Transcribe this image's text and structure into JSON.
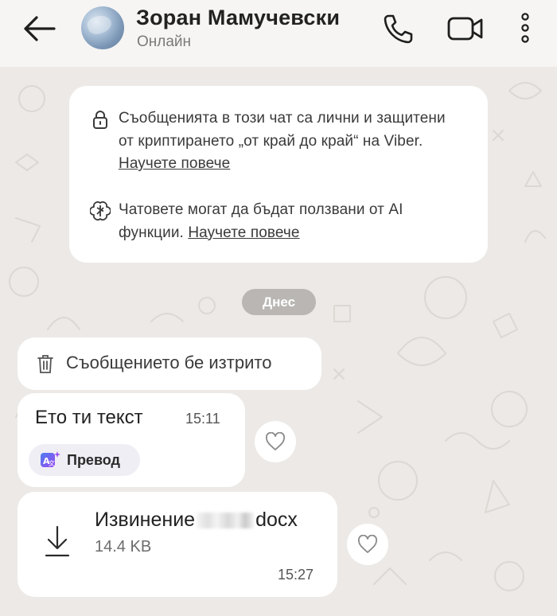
{
  "header": {
    "contact_name": "Зоран Мамучевски",
    "status": "Онлайн",
    "icons": [
      "back-arrow-icon",
      "phone-icon",
      "video-camera-icon",
      "more-vertical-icon"
    ]
  },
  "chat": {
    "info": {
      "encryption_text": "Съобщенията в този чат са лични и защитени от криптирането „от край до край“ на Viber.",
      "encryption_link": "Научете повече",
      "ai_text": "Чатовете могат да бъдат ползвани от AI функции.",
      "ai_link": "Научете повече"
    },
    "date_divider": "Днес",
    "messages": {
      "deleted": {
        "text": "Съобщението бе изтрито"
      },
      "text_message": {
        "text": "Ето ти текст",
        "time": "15:11",
        "translate_label": "Превод"
      },
      "file_message": {
        "name_prefix": "Извинение",
        "name_suffix": "docx",
        "size": "14.4 KB",
        "time": "15:27"
      }
    }
  },
  "colors": {
    "background": "#ece9e6",
    "header": "#f6f5f4",
    "bubble": "#ffffff",
    "date_pill": "#b9b6b3"
  }
}
